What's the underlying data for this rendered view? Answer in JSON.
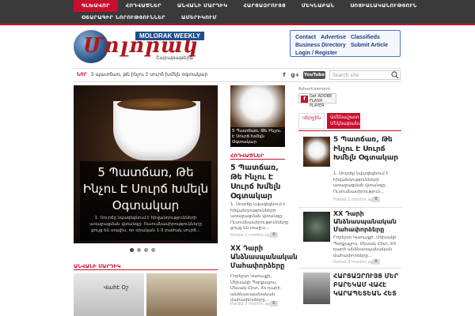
{
  "nav": {
    "row1": [
      "ԳԼԽԱՎՈՐ",
      "ՀՈԴՎԱԾՆԵՐ",
      "ԱՆՎԱՆԻ ՄԱՐԴԻԿ",
      "ՀԱՐՑԱԶՐՈՒՅՑ",
      "ՄԵԿՆԱԲԱՆ",
      "ՍՈՑԻԱԼԱԿԱՆՈՒԹՅՈՒՆ"
    ],
    "row2": [
      "ՕՏԱՐԱԳԻՐ ՆՈՐՈՒԹՅՈՒՆՆԵՐ",
      "ԱՄԵՐԻԿՈՒՄ"
    ]
  },
  "logo": {
    "script_text": "Մոլորակ",
    "weekly_badge": "MOLORAK WEEKLY",
    "subtitle": "Շաբաթաթերթ"
  },
  "links_box": {
    "row1": [
      "Contact",
      "Advertise",
      "Classifieds"
    ],
    "row2": [
      "Business Directory",
      "Submit Article"
    ],
    "row3": [
      "Login / Register"
    ]
  },
  "ticker": {
    "label": "ՆՈՐ",
    "text": "5 պատճառ, թե ինչու է սուրճ խմելն օգտակար",
    "social": [
      "f",
      "g+",
      "YouTube"
    ],
    "search_placeholder": "Search site"
  },
  "slider": {
    "title": "5 Պատճառ, Թե Ինչու Է Սուրճ Խմելն Օգտակար",
    "excerpt": "1. Սուրճը նվազեցնում է հիվանդությունների առաջացման վտանգը: Ուսումնասիրությունները ցույց են տալիս, որ օրական 1-3 բաժակ սուրճ..."
  },
  "sections": {
    "popular_people": "ԱՆՎԱՆԻ ՄԱՐԴԻԿ",
    "articles": "ՀՈԴՎԱԾՆԵՐ"
  },
  "people_thumbs": [
    {
      "label": "Վահէ Օշ"
    }
  ],
  "mid_column": {
    "image_caption": "5 Պատճառ, Թե Ինչու Է Սուրճ Խմելն Օգտակար",
    "articles": [
      {
        "title": "5 Պատճառ, Թե Ինչու Է Սուրճ Խմելն Օգտակար",
        "excerpt": "1. Սուրճը նվազեցնում է հիվանդությունների առաջացման վտանգը: Ուսումնասիրությունները ցույց են տալիս...",
        "meta": "Posted 2 months ago",
        "comments": "0"
      },
      {
        "title": "XX Դարի Անձնասպանական Մահափորձերը",
        "excerpt": "Րոբերտ Կաուսքի, Մեխակի Պօրքալյոս, Մեսակ Հիտ, Xx դարի անձնասպանական մահափորձերը...",
        "meta": "Posted 3 months ago",
        "comments": "0"
      }
    ]
  },
  "sidebar": {
    "ad_label": "Advertisement",
    "flash_text": "Get ADOBE FLASH PLAYER",
    "tabs": [
      "Վերջին",
      "Ամենաշատ Մեկնաբանված"
    ],
    "articles": [
      {
        "title": "5 Պատճառ, Թե Ինչու Է Սուրճ Խմելն Օգտակար",
        "excerpt": "1. Սուրճը նվազեցնում է հիվանդությունների առաջացման վտանգը: Ուսումնասիրություն...",
        "meta": "Posted 2 months ago",
        "comments": "0"
      },
      {
        "title": "XX Դարի Անձնասպանական Մահափորձերը",
        "excerpt": "Րոբերտ Կաուսքի, Մեխակի Պօրքալյոս, Մեսակ Հիտ, XX դարի անձնասպանական մահափորձերը...",
        "meta": "Posted 3 months ago",
        "comments": "0"
      },
      {
        "title": "ՀԱՐՑԱԶՐՈՒՅՑ ՄԵՐ ԲԱՐԵԿԱՄ ՎԱՀԷ ԿԱՐԱՊԵՏԵԱՆ ՀԵՏ"
      }
    ]
  }
}
